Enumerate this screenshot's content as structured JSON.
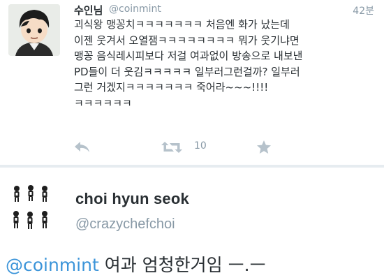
{
  "tweet": {
    "display_name": "수인님",
    "handle": "@coinmint",
    "time": "42분",
    "lines": [
      "괴식왕 맹꽁치ㅋㅋㅋㅋㅋㅋㅋ 처음엔 화가 났는데",
      "이젠 웃겨서 오열잼ㅋㅋㅋㅋㅋㅋㅋㅋ 뭐가 웃기냐면",
      "맹꽁 음식레시피보다 저걸 여과없이 방송으로 내보낸",
      "PD들이 더 웃김ㅋㅋㅋㅋㅋ 일부러그런걸까? 일부러",
      "그런 거겠지ㅋㅋㅋㅋㅋㅋㅋ 죽어라~~~!!!!",
      "ㅋㅋㅋㅋㅋㅋ"
    ],
    "retweet_count": "10",
    "icons": {
      "reply": "reply-icon",
      "retweet": "retweet-icon",
      "favorite": "star-icon"
    },
    "colors": {
      "muted": "#8899a6",
      "text": "#292f33"
    }
  },
  "profile": {
    "name": "choi hyun seok",
    "handle": "@crazychefchoi"
  },
  "reply": {
    "mention": "@coinmint",
    "text": " 여과 엄청한거임 ㅡ.ㅡ",
    "colors": {
      "mention": "#3b94d9"
    }
  }
}
